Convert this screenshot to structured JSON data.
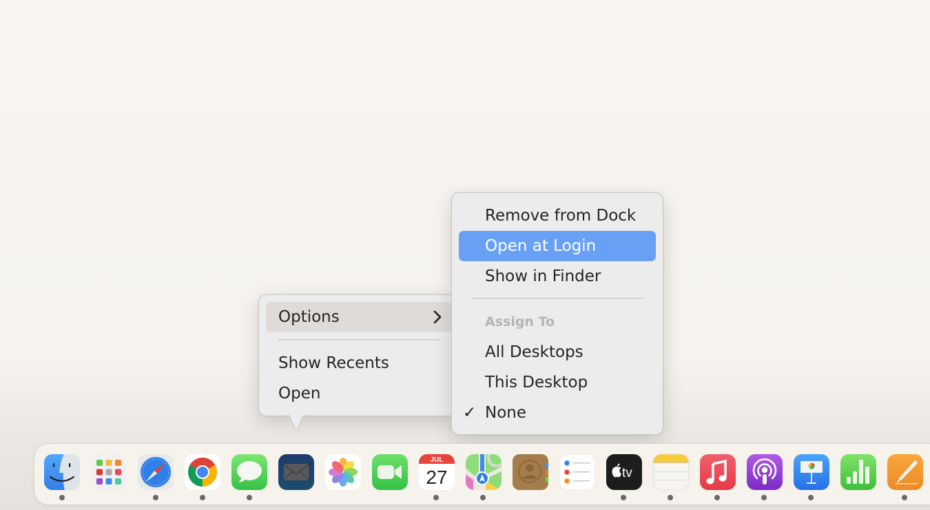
{
  "context_menu": {
    "items": [
      {
        "label": "Options",
        "has_submenu": true,
        "highlighted": true
      },
      {
        "label": "Show Recents"
      },
      {
        "label": "Open"
      }
    ]
  },
  "options_submenu": {
    "items": [
      {
        "label": "Remove from Dock"
      },
      {
        "label": "Open at Login",
        "selected": true
      },
      {
        "label": "Show in Finder"
      }
    ],
    "assign_header": "Assign To",
    "assign_options": [
      {
        "label": "All Desktops",
        "checked": false
      },
      {
        "label": "This Desktop",
        "checked": false
      },
      {
        "label": "None",
        "checked": true
      }
    ],
    "check_glyph": "✓",
    "chevron_glyph": "›"
  },
  "accent_color": "#67a0f4",
  "dock": {
    "apps": [
      {
        "name": "Finder",
        "icon": "finder-icon",
        "running": true
      },
      {
        "name": "Launchpad",
        "icon": "launchpad-icon",
        "running": false
      },
      {
        "name": "Safari",
        "icon": "safari-icon",
        "running": true
      },
      {
        "name": "Google Chrome",
        "icon": "chrome-icon",
        "running": true
      },
      {
        "name": "Messages",
        "icon": "messages-icon",
        "running": true
      },
      {
        "name": "Mail",
        "icon": "mail-icon",
        "running": false
      },
      {
        "name": "Photos",
        "icon": "photos-icon",
        "running": false
      },
      {
        "name": "FaceTime",
        "icon": "facetime-icon",
        "running": false
      },
      {
        "name": "Calendar",
        "icon": "calendar-icon",
        "running": true
      },
      {
        "name": "Maps",
        "icon": "maps-icon",
        "running": true
      },
      {
        "name": "Contacts",
        "icon": "contacts-icon",
        "running": false
      },
      {
        "name": "Reminders",
        "icon": "reminders-icon",
        "running": false
      },
      {
        "name": "TV",
        "icon": "tv-icon",
        "running": true
      },
      {
        "name": "Notes",
        "icon": "notes-icon",
        "running": true
      },
      {
        "name": "Music",
        "icon": "music-icon",
        "running": true
      },
      {
        "name": "Podcasts",
        "icon": "podcasts-icon",
        "running": true
      },
      {
        "name": "Keynote",
        "icon": "keynote-icon",
        "running": true
      },
      {
        "name": "Numbers",
        "icon": "numbers-icon",
        "running": false
      },
      {
        "name": "Pages",
        "icon": "pages-icon",
        "running": true
      }
    ],
    "calendar": {
      "month": "JUL",
      "day": "27"
    },
    "tv_label": "tv"
  }
}
